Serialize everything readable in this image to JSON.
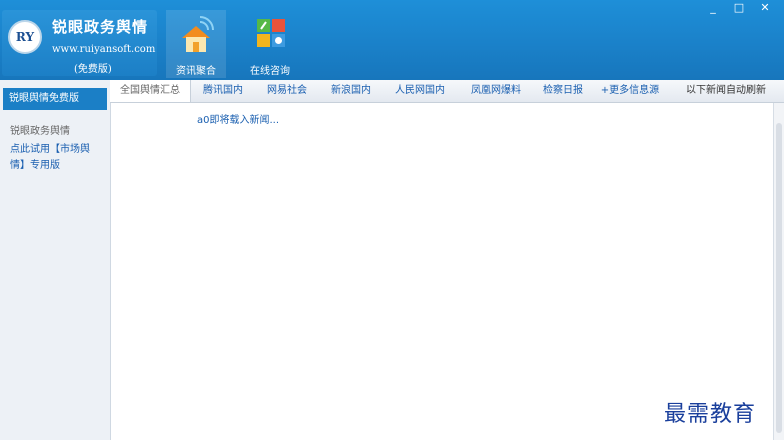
{
  "app": {
    "logo_mark": "RY",
    "title": "锐眼政务舆情",
    "url": "www.ruiyansoft.com",
    "edition": "(免费版)"
  },
  "top_tabs": [
    {
      "label": "资讯聚合",
      "icon": "house-wifi-icon",
      "active": true
    },
    {
      "label": "在线咨询",
      "icon": "tools-grid-icon",
      "active": false
    }
  ],
  "window_controls": [
    "_",
    "□",
    "✕"
  ],
  "sidebar": {
    "active_item": "锐眼舆情免费版",
    "heading": "锐眼政务舆情",
    "link_text": "点此试用【市场舆情】专用版"
  },
  "news_tabs": [
    {
      "label": "全国舆情汇总",
      "selected": true
    },
    {
      "label": "腾讯国内"
    },
    {
      "label": "网易社会"
    },
    {
      "label": "新浪国内"
    },
    {
      "label": "人民网国内"
    },
    {
      "label": "凤凰网爆料"
    },
    {
      "label": "检察日报"
    },
    {
      "label": "+更多信息源"
    },
    {
      "label": "以下新闻自动刷新",
      "plain": true
    }
  ],
  "content": {
    "loading_text": "a0即将载入新闻..."
  },
  "watermark": "最需教育",
  "colors": {
    "titlebar": "#1a80c8",
    "accent": "#1b7fc6",
    "link": "#1a5fb0"
  }
}
